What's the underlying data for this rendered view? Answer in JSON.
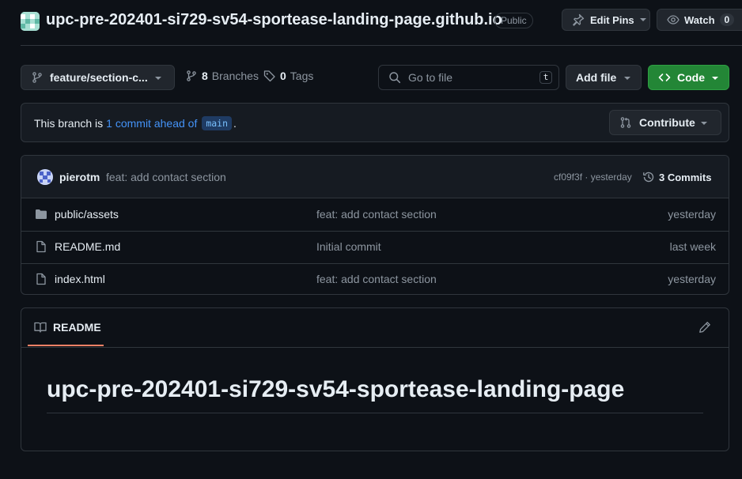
{
  "header": {
    "repo_name": "upc-pre-202401-si729-sv54-sportease-landing-page.github.io",
    "visibility": "Public",
    "edit_pins_label": "Edit Pins",
    "watch_label": "Watch",
    "watch_count": "0"
  },
  "toolbar": {
    "branch": "feature/section-c...",
    "branches_count": "8",
    "branches_label": "Branches",
    "tags_count": "0",
    "tags_label": "Tags",
    "go_to_file_placeholder": "Go to file",
    "go_to_file_shortcut": "t",
    "add_file_label": "Add file",
    "code_label": "Code"
  },
  "ahead_banner": {
    "prefix": "This branch is",
    "link_text": "1 commit ahead of",
    "base_branch": "main",
    "suffix": ".",
    "contribute_label": "Contribute"
  },
  "latest_commit": {
    "author": "pierotm",
    "message": "feat: add contact section",
    "hash": "cf09f3f",
    "separator": "·",
    "time": "yesterday",
    "commits_label": "3 Commits"
  },
  "files": [
    {
      "type": "folder",
      "name": "public/assets",
      "message": "feat: add contact section",
      "date": "yesterday"
    },
    {
      "type": "file",
      "name": "README.md",
      "message": "Initial commit",
      "date": "last week"
    },
    {
      "type": "file",
      "name": "index.html",
      "message": "feat: add contact section",
      "date": "yesterday"
    }
  ],
  "readme": {
    "tab_label": "README",
    "title": "upc-pre-202401-si729-sv54-sportease-landing-page"
  },
  "colors": {
    "background": "#0d1117",
    "primary_button": "#238636",
    "link": "#4493f8",
    "tab_underline": "#f78166"
  }
}
